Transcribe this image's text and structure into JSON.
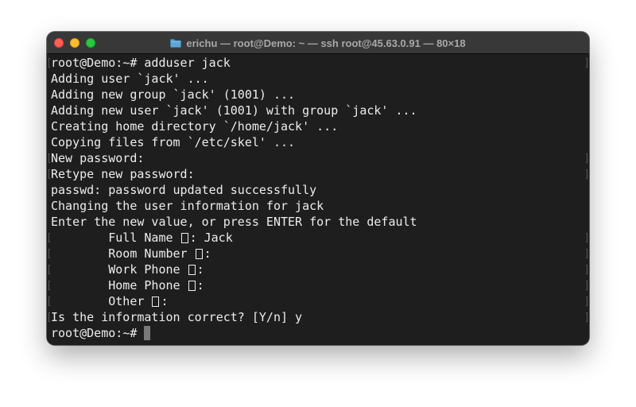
{
  "window": {
    "title": "erichu — root@Demo: ~ — ssh root@45.63.0.91 — 80×18",
    "title_icon": "folder-icon"
  },
  "terminal": {
    "lines": [
      {
        "text": "root@Demo:~# adduser jack",
        "wrap_left": true,
        "wrap_right": true
      },
      {
        "text": "Adding user `jack' ..."
      },
      {
        "text": "Adding new group `jack' (1001) ..."
      },
      {
        "text": "Adding new user `jack' (1001) with group `jack' ..."
      },
      {
        "text": "Creating home directory `/home/jack' ..."
      },
      {
        "text": "Copying files from `/etc/skel' ..."
      },
      {
        "text": "New password:",
        "wrap_left": true,
        "wrap_right": true
      },
      {
        "text": "Retype new password:",
        "wrap_left": true,
        "wrap_right": true
      },
      {
        "text": "passwd: password updated successfully"
      },
      {
        "text": "Changing the user information for jack"
      },
      {
        "text": "Enter the new value, or press ENTER for the default"
      },
      {
        "prefix": "        Full Name ",
        "suffix": ": Jack",
        "wrap_left": true,
        "wrap_right": true
      },
      {
        "prefix": "        Room Number ",
        "suffix": ":",
        "wrap_left": true,
        "wrap_right": true
      },
      {
        "prefix": "        Work Phone ",
        "suffix": ":",
        "wrap_left": true,
        "wrap_right": true
      },
      {
        "prefix": "        Home Phone ",
        "suffix": ":",
        "wrap_left": true,
        "wrap_right": true
      },
      {
        "prefix": "        Other ",
        "suffix": ":",
        "wrap_left": true,
        "wrap_right": true
      },
      {
        "text": "Is the information correct? [Y/n] y",
        "wrap_left": true,
        "wrap_right": true
      },
      {
        "text": "root@Demo:~# ",
        "cursor": true
      }
    ]
  },
  "colors": {
    "background": "#1e1e1e",
    "foreground": "#ededed",
    "titlebar": "#383838",
    "close": "#fe5f57",
    "minimize": "#febc2e",
    "zoom": "#28c840"
  }
}
